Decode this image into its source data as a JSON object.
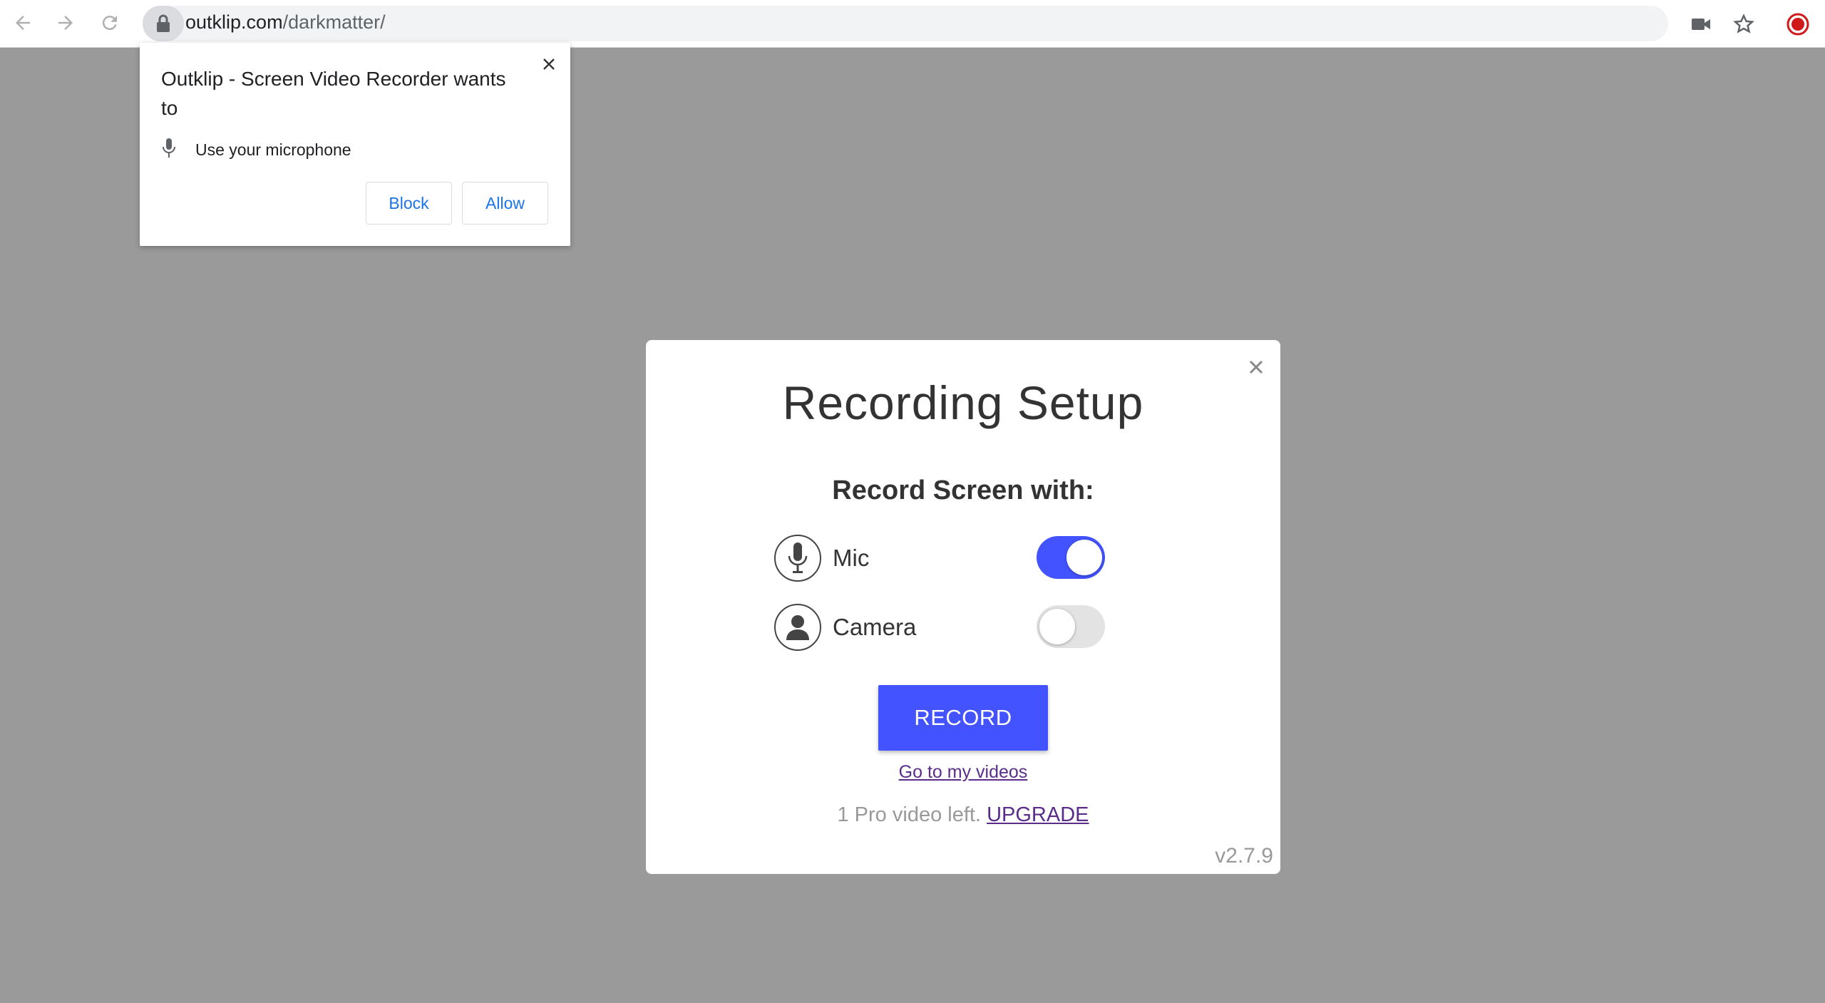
{
  "browser": {
    "url_domain": "outklip.com",
    "url_path": "/darkmatter/",
    "icons": [
      "back-arrow-icon",
      "forward-arrow-icon",
      "reload-icon",
      "lock-icon",
      "video-camera-icon",
      "star-icon",
      "extension-icon"
    ]
  },
  "permission_popup": {
    "title": "Outklip - Screen Video Recorder wants to",
    "request": "Use your microphone",
    "block_label": "Block",
    "allow_label": "Allow",
    "accent": "#1a73e8"
  },
  "modal": {
    "title": "Recording Setup",
    "subtitle": "Record Screen with:",
    "options": [
      {
        "label": "Mic",
        "enabled": true,
        "icon": "microphone-icon"
      },
      {
        "label": "Camera",
        "enabled": false,
        "icon": "person-icon"
      }
    ],
    "record_label": "RECORD",
    "videos_link": "Go to my videos",
    "pro_text": "1 Pro video left.",
    "upgrade_label": "UPGRADE",
    "version": "v2.7.9",
    "accent": "#4353ff"
  }
}
